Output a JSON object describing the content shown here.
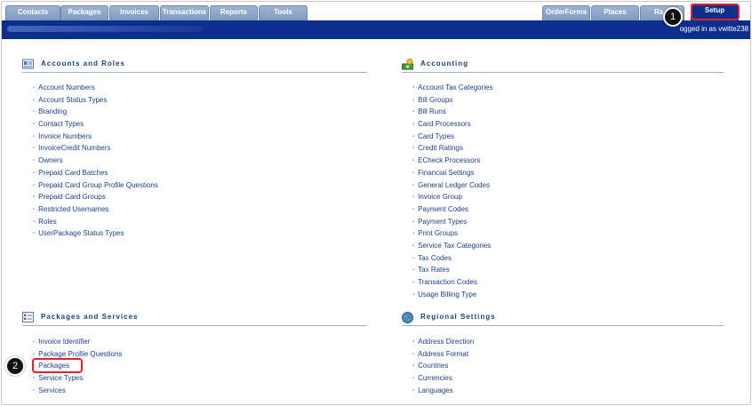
{
  "tabs_left": [
    "Contacts",
    "Packages",
    "Invoices",
    "Transactions",
    "Reports",
    "Tools"
  ],
  "tabs_right": [
    "OrderForms",
    "Places",
    "Ra",
    "Setup"
  ],
  "login_text": "ogged in as vwitte238",
  "accounts_roles": {
    "title": "Accounts and Roles",
    "items": [
      "Account Numbers",
      "Account Status Types",
      "Branding",
      "Contact Types",
      "Invoice Numbers",
      "InvoiceCredit Numbers",
      "Owners",
      "Prepaid Card Batches",
      "Prepaid Card Group Profile Questions",
      "Prepaid Card Groups",
      "Restricted Usernames",
      "Roles",
      "UserPackage Status Types"
    ]
  },
  "accounting": {
    "title": "Accounting",
    "items": [
      "Account Tax Categories",
      "Bill Groups",
      "Bill Runs",
      "Card Processors",
      "Card Types",
      "Credit Ratings",
      "ECheck Processors",
      "Financial Settings",
      "General Ledger Codes",
      "Invoice Group",
      "Payment Codes",
      "Payment Types",
      "Print Groups",
      "Service Tax Categories",
      "Tax Codes",
      "Tax Rates",
      "Transaction Codes",
      "Usage Billing Type"
    ]
  },
  "packages_services": {
    "title": "Packages and Services",
    "items": [
      "Invoice Identifier",
      "Package Profile Questions",
      "Packages",
      "Service Types",
      "Services"
    ]
  },
  "regional": {
    "title": "Regional Settings",
    "items": [
      "Address Direction",
      "Address Format",
      "Countries",
      "Currencies",
      "Languages"
    ]
  },
  "annotations": [
    "1",
    "2"
  ],
  "colors": {
    "nav_blue": "#0c2e8f",
    "tab_blue": "#8aa3c8",
    "link": "#1d3f8c",
    "callout_red": "#e4202a"
  },
  "icons": {
    "accounts_roles": "address-card-icon",
    "accounting": "money-icon",
    "packages_services": "checklist-icon",
    "regional": "globe-icon"
  }
}
